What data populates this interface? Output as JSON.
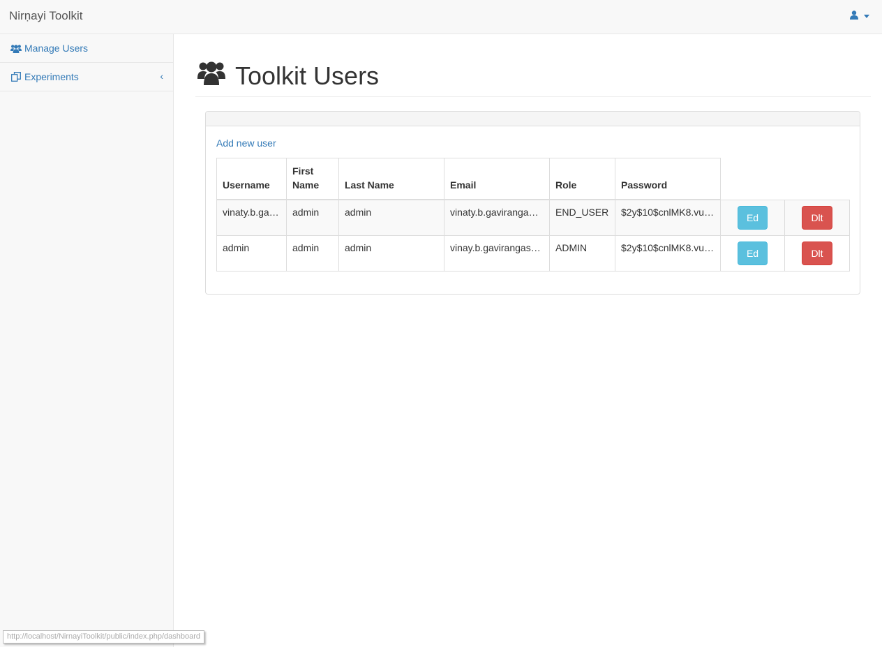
{
  "navbar": {
    "brand": "Nirṇayi Toolkit",
    "user_icon": "user-icon"
  },
  "sidebar": {
    "items": [
      {
        "label": "Manage Users",
        "icon": "users-icon"
      },
      {
        "label": "Experiments",
        "icon": "copy-icon"
      }
    ]
  },
  "main": {
    "title": "Toolkit Users",
    "add_link": "Add new user",
    "columns": [
      "Username",
      "First Name",
      "Last Name",
      "Email",
      "Role",
      "Password"
    ],
    "rows": [
      {
        "username": "vinaty.b.gaviranga…",
        "first": "admin",
        "last": "admin",
        "email": "vinaty.b.gaviranga…",
        "role": "END_USER",
        "password": "$2y$10$cnlMK8.vu…",
        "edit": "Ed",
        "delete": "Dlt"
      },
      {
        "username": "admin",
        "first": "admin",
        "last": "admin",
        "email": "vinay.b.gavirangas…",
        "role": "ADMIN",
        "password": "$2y$10$cnlMK8.vu…",
        "edit": "Ed",
        "delete": "Dlt"
      }
    ]
  },
  "statusbar": {
    "url": "http://localhost/NirnayiToolkit/public/index.php/dashboard"
  },
  "colors": {
    "link": "#337ab7",
    "info": "#5bc0de",
    "danger": "#d9534f"
  }
}
